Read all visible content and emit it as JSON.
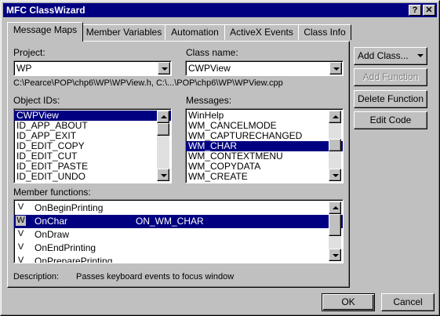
{
  "window": {
    "title": "MFC ClassWizard",
    "help_glyph": "?",
    "close_glyph": "✕"
  },
  "tabs": [
    {
      "label": "Message Maps"
    },
    {
      "label": "Member Variables"
    },
    {
      "label": "Automation"
    },
    {
      "label": "ActiveX Events"
    },
    {
      "label": "Class Info"
    }
  ],
  "project": {
    "label": "Project:",
    "value": "WP"
  },
  "class_name": {
    "label": "Class name:",
    "value": "CWPView"
  },
  "path": "C:\\Pearce\\POP\\chp6\\WP\\WPView.h, C:\\...\\POP\\chp6\\WP\\WPView.cpp",
  "object_ids": {
    "label": "Object IDs:",
    "items": [
      "CWPView",
      "ID_APP_ABOUT",
      "ID_APP_EXIT",
      "ID_EDIT_COPY",
      "ID_EDIT_CUT",
      "ID_EDIT_PASTE",
      "ID_EDIT_UNDO"
    ]
  },
  "messages": {
    "label": "Messages:",
    "items": [
      "WinHelp",
      "WM_CANCELMODE",
      "WM_CAPTURECHANGED",
      "WM_CHAR",
      "WM_CONTEXTMENU",
      "WM_COPYDATA",
      "WM_CREATE"
    ]
  },
  "member_functions": {
    "label": "Member functions:",
    "rows": [
      {
        "v": "V",
        "name": "OnBeginPrinting",
        "handler": ""
      },
      {
        "v": "W",
        "name": "OnChar",
        "handler": "ON_WM_CHAR"
      },
      {
        "v": "V",
        "name": "OnDraw",
        "handler": ""
      },
      {
        "v": "V",
        "name": "OnEndPrinting",
        "handler": ""
      },
      {
        "v": "V",
        "name": "OnPreparePrinting",
        "handler": ""
      }
    ]
  },
  "description": {
    "label": "Description:",
    "text": "Passes keyboard events to focus window"
  },
  "side_buttons": {
    "add_class": "Add Class...",
    "add_function": "Add Function",
    "delete_function": "Delete Function",
    "edit_code": "Edit Code"
  },
  "footer": {
    "ok": "OK",
    "cancel": "Cancel"
  }
}
